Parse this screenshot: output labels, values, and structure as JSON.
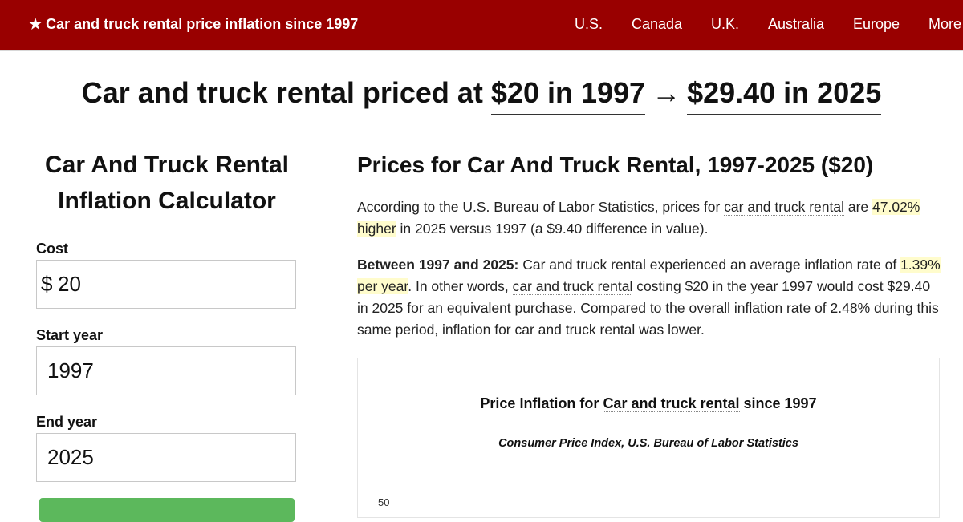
{
  "header": {
    "brand": "★ Car and truck rental price inflation since 1997",
    "nav": [
      "U.S.",
      "Canada",
      "U.K.",
      "Australia",
      "Europe",
      "More"
    ]
  },
  "headline": {
    "prefix": "Car and truck rental priced at",
    "start": "$20 in 1997",
    "arrow": "→",
    "end": "$29.40 in 2025"
  },
  "calculator": {
    "title_line1": "Car And Truck Rental",
    "title_line2": "Inflation Calculator",
    "cost_label": "Cost",
    "currency": "$",
    "cost_value": "20",
    "start_label": "Start year",
    "start_value": "1997",
    "end_label": "End year",
    "end_value": "2025"
  },
  "main": {
    "title": "Prices for Car And Truck Rental, 1997-2025 ($20)",
    "p1": {
      "a": "According to the U.S. Bureau of Labor Statistics, prices for ",
      "b": "car and truck rental",
      "c": " are ",
      "d": "47.02% higher",
      "e": " in 2025 versus 1997 (a $9.40 difference in value)."
    },
    "p2": {
      "a": "Between 1997 and 2025:",
      "b": " ",
      "c": "Car and truck rental",
      "d": " experienced an average inflation rate of ",
      "e": "1.39% per year",
      "f": ". In other words, ",
      "g": "car and truck rental",
      "h": " costing $20 in the year 1997 would cost $29.40 in 2025 for an equivalent purchase. Compared to the overall inflation rate of 2.48% during this same period, inflation for ",
      "i": "car and truck rental",
      "j": " was lower."
    }
  },
  "chart": {
    "title_a": "Price Inflation for ",
    "title_b": "Car and truck rental",
    "title_c": " since 1997",
    "subtitle": "Consumer Price Index, U.S. Bureau of Labor Statistics",
    "y_tick": "50"
  }
}
